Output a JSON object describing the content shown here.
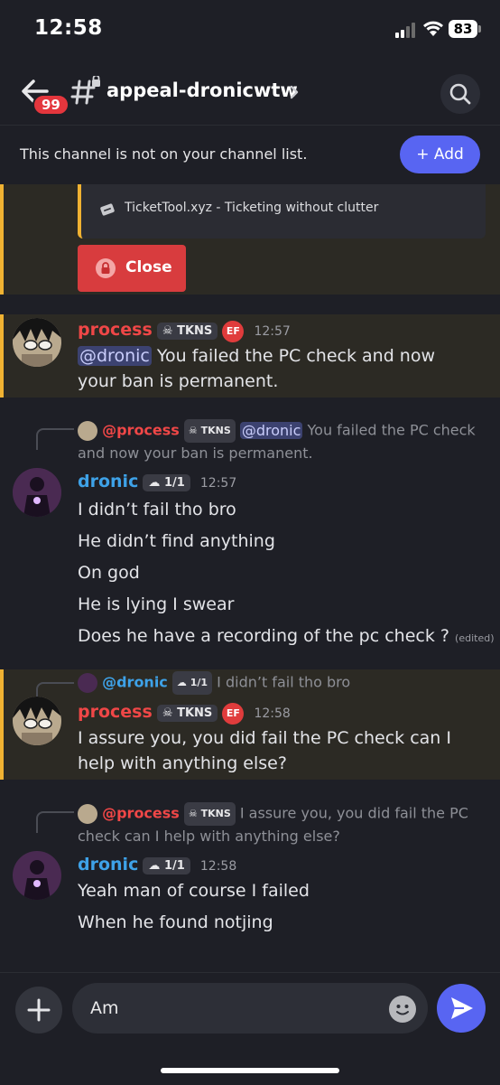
{
  "status": {
    "time": "12:58",
    "battery": "83"
  },
  "header": {
    "badge": "99",
    "channel": "appeal-dronicwtw"
  },
  "notice": {
    "text": "This channel is not on your channel list.",
    "add_label": "+ Add"
  },
  "embed": {
    "footer": "TicketTool.xyz - Ticketing without clutter",
    "close_label": "Close"
  },
  "messages": [
    {
      "author": "process",
      "tag": "TKNS",
      "badge": "EF",
      "time": "12:57",
      "mention": "@dronic",
      "text": "You failed the PC check and now your ban is permanent."
    },
    {
      "reply": {
        "author": "@process",
        "tag": "TKNS",
        "mention": "@dronic",
        "text": "You failed the PC check and now your ban is permanent."
      },
      "author": "dronic",
      "tag": "1/1",
      "time": "12:57",
      "lines": [
        "I didn’t fail tho bro",
        "He didn’t find anything",
        "On god",
        "He is lying I swear",
        "Does he have a recording of the pc check ?"
      ],
      "edited": "(edited)"
    },
    {
      "reply": {
        "author": "@dronic",
        "tag": "1/1",
        "text": "I didn’t fail tho bro"
      },
      "author": "process",
      "tag": "TKNS",
      "badge": "EF",
      "time": "12:58",
      "text": "I assure you, you did fail the PC check can I help with anything else?"
    },
    {
      "reply": {
        "author": "@process",
        "tag": "TKNS",
        "text": "I assure you, you did fail the PC check can I help with anything else?"
      },
      "author": "dronic",
      "tag": "1/1",
      "time": "12:58",
      "lines": [
        "Yeah man of course I failed",
        "When he found notjing"
      ]
    }
  ],
  "composer": {
    "value": "Am"
  },
  "colors": {
    "accent": "#5865f2",
    "process": "#f04747",
    "dronic": "#3ea2e8",
    "highlight_bar": "#f0b232"
  }
}
